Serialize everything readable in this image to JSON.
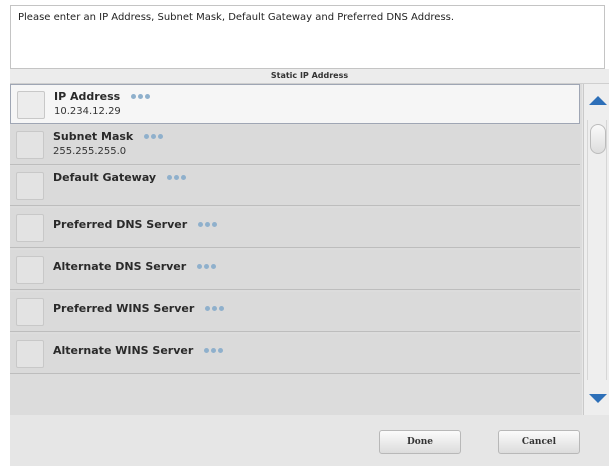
{
  "instruction": "Please enter an IP Address, Subnet Mask, Default Gateway and Preferred DNS Address.",
  "section_title": "Static IP Address",
  "fields": [
    {
      "label": "IP Address",
      "value": "10.234.12.29",
      "selected": true
    },
    {
      "label": "Subnet Mask",
      "value": "255.255.255.0",
      "selected": false
    },
    {
      "label": "Default Gateway",
      "value": "",
      "selected": false
    },
    {
      "label": "Preferred DNS Server",
      "value": "",
      "selected": false
    },
    {
      "label": "Alternate DNS Server",
      "value": "",
      "selected": false
    },
    {
      "label": "Preferred WINS Server",
      "value": "",
      "selected": false
    },
    {
      "label": "Alternate WINS Server",
      "value": "",
      "selected": false
    }
  ],
  "icons": {
    "more": "ellipsis-icon",
    "scroll_up": "arrow-up-icon",
    "scroll_down": "arrow-down-icon"
  },
  "colors": {
    "accent": "#2d6fb8",
    "ellipsis_dots": "#8fb0cc",
    "selected_row": "#f6f6f6"
  },
  "buttons": {
    "done": "Done",
    "cancel": "Cancel"
  }
}
